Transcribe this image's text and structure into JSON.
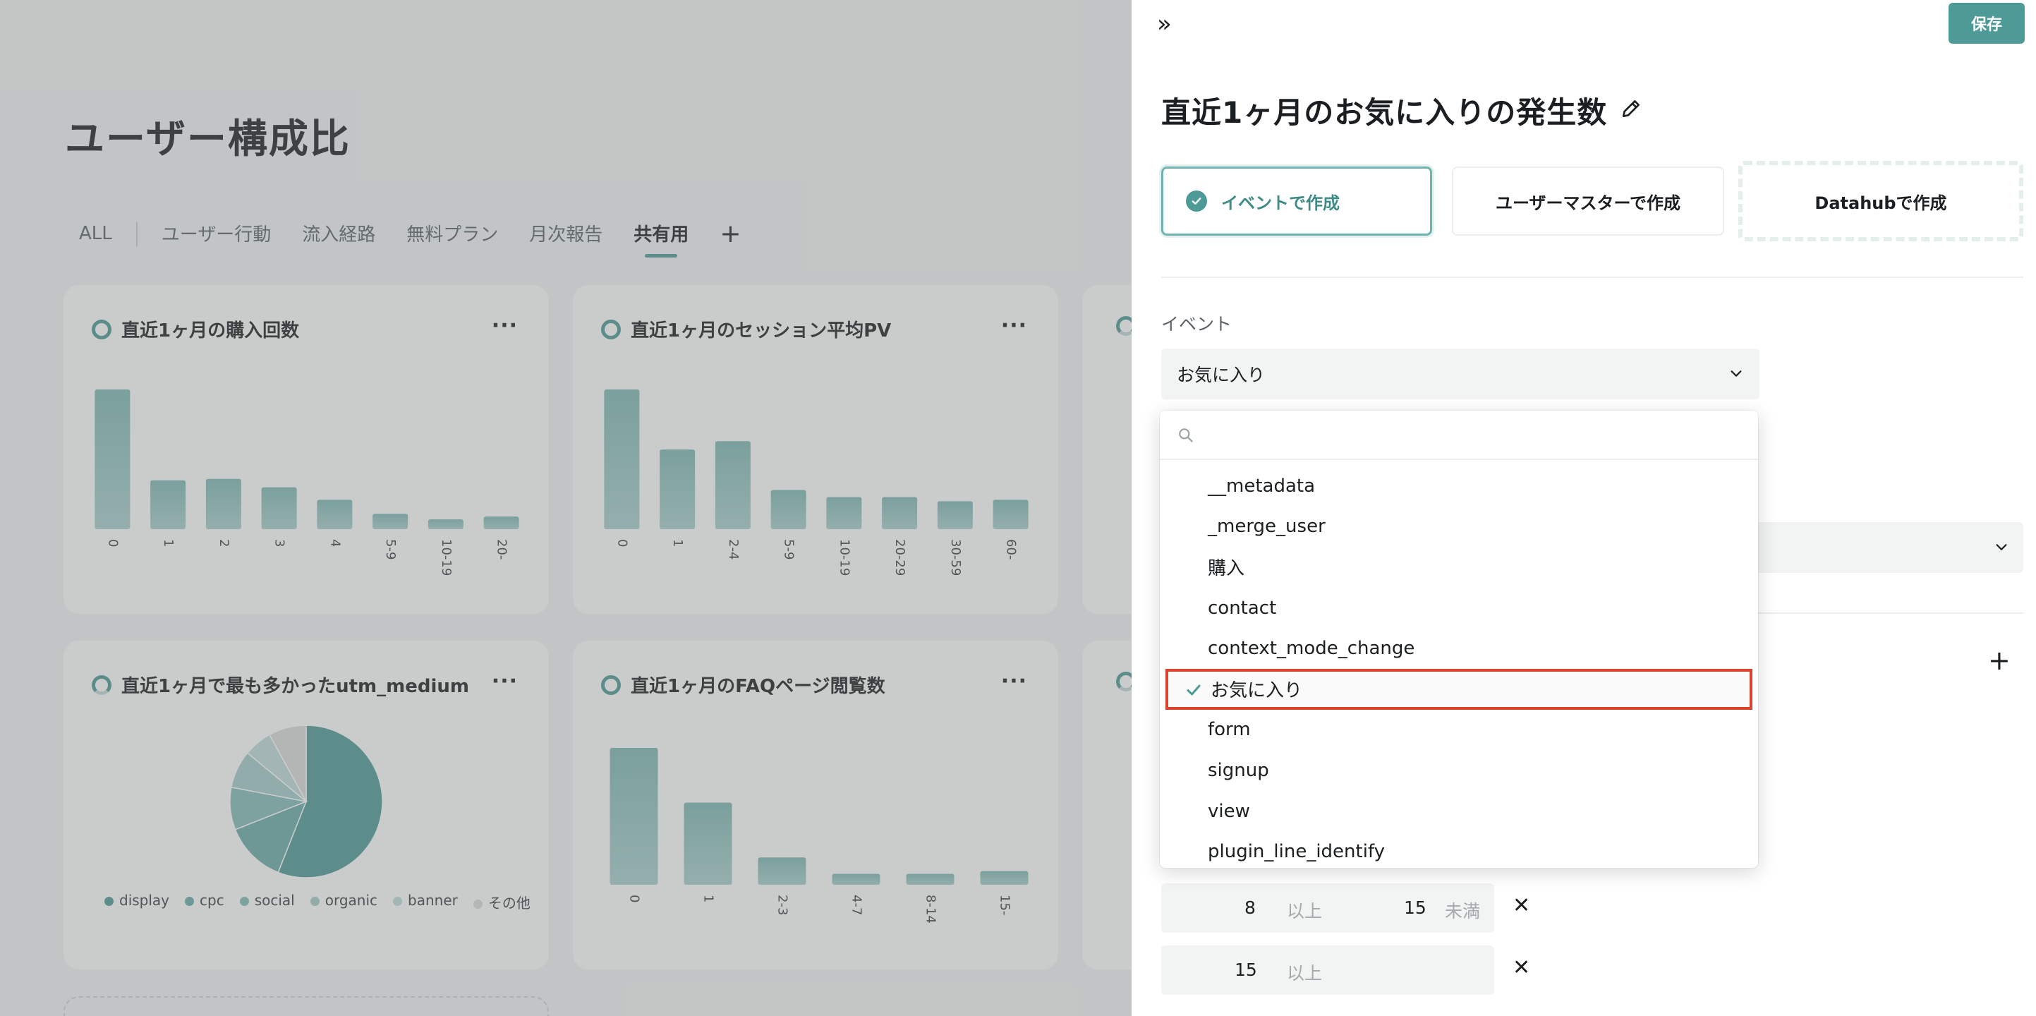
{
  "dashboard": {
    "title": "ユーザー構成比",
    "tabs": [
      "ALL",
      "ユーザー行動",
      "流入経路",
      "無料プラン",
      "月次報告",
      "共有用"
    ],
    "active_tab": "共有用",
    "add_tab_label": "+",
    "cards": [
      {
        "title": "直近1ヶ月の購入回数",
        "menu": "···"
      },
      {
        "title": "直近1ヶ月のセッション平均PV",
        "menu": "···"
      },
      {
        "title": "直近1ヶ月で最も多かったutm_medium",
        "menu": "···"
      },
      {
        "title": "直近1ヶ月のFAQページ閲覧数",
        "menu": "···"
      }
    ]
  },
  "chart_data": [
    {
      "type": "bar",
      "title": "直近1ヶ月の購入回数",
      "categories": [
        "0",
        "1",
        "2",
        "3",
        "4",
        "5-9",
        "10-19",
        "20-"
      ],
      "values": [
        100,
        35,
        36,
        30,
        21,
        11,
        7,
        9
      ]
    },
    {
      "type": "bar",
      "title": "直近1ヶ月のセッション平均PV",
      "categories": [
        "0",
        "1",
        "2-4",
        "5-9",
        "10-19",
        "20-29",
        "30-59",
        "60-"
      ],
      "values": [
        100,
        57,
        63,
        28,
        23,
        23,
        20,
        21
      ]
    },
    {
      "type": "pie",
      "title": "直近1ヶ月で最も多かったutm_medium",
      "categories": [
        "display",
        "cpc",
        "social",
        "organic",
        "banner",
        "その他"
      ],
      "values": [
        56,
        13,
        9,
        8,
        6,
        8
      ],
      "colors": [
        "#4e9a96",
        "#6aaba7",
        "#85bcb8",
        "#a3ccc9",
        "#c1dcda",
        "#dcdcdc"
      ]
    },
    {
      "type": "bar",
      "title": "直近1ヶ月のFAQページ閲覧数",
      "categories": [
        "0",
        "1",
        "2-3",
        "4-7",
        "8-14",
        "15-"
      ],
      "values": [
        100,
        60,
        20,
        8,
        8,
        10
      ]
    }
  ],
  "panel": {
    "collapse_icon": "»",
    "save_label": "保存",
    "title": "直近1ヶ月のお気に入りの発生数",
    "modes": {
      "event": "イベントで作成",
      "user_master": "ユーザーマスターで作成",
      "datahub": "Datahubで作成"
    },
    "event_label": "イベント",
    "event_value": "お気に入り",
    "add_icon": "+",
    "ranges": [
      {
        "from": "8",
        "from_unit": "以上",
        "to": "15",
        "to_unit": "未満"
      },
      {
        "from": "15",
        "from_unit": "以上"
      }
    ],
    "remove_icon": "✕"
  },
  "dropdown": {
    "search_placeholder": "",
    "selected": "お気に入り",
    "options": [
      "__metadata",
      "_merge_user",
      "購入",
      "contact",
      "context_mode_change",
      "お気に入り",
      "form",
      "signup",
      "view",
      "plugin_line_identify"
    ]
  },
  "colors": {
    "accent": "#4e9a96",
    "highlight_border": "#d9432f",
    "bar_fill": "#8fc3bf"
  }
}
